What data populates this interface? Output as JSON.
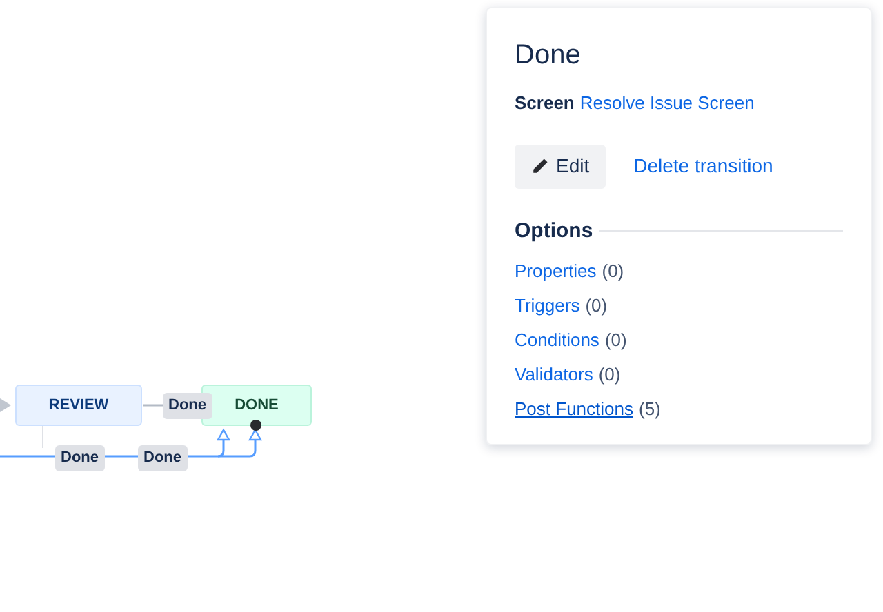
{
  "diagram": {
    "statuses": [
      {
        "label": "REVIEW",
        "kind": "in_progress"
      },
      {
        "label": "DONE",
        "kind": "done"
      }
    ],
    "transition_labels": [
      {
        "label": "Done",
        "selected": false
      },
      {
        "label": "Done",
        "selected": false
      },
      {
        "label": "Done",
        "selected": false
      }
    ]
  },
  "panel": {
    "title": "Done",
    "screen_label": "Screen",
    "screen_link": "Resolve Issue Screen",
    "edit_button": "Edit",
    "delete_link": "Delete transition",
    "options_heading": "Options",
    "options": [
      {
        "name": "Properties",
        "count": "(0)",
        "hovered": false
      },
      {
        "name": "Triggers",
        "count": "(0)",
        "hovered": false
      },
      {
        "name": "Conditions",
        "count": "(0)",
        "hovered": false
      },
      {
        "name": "Validators",
        "count": "(0)",
        "hovered": false
      },
      {
        "name": "Post Functions",
        "count": "(5)",
        "hovered": true
      }
    ]
  }
}
